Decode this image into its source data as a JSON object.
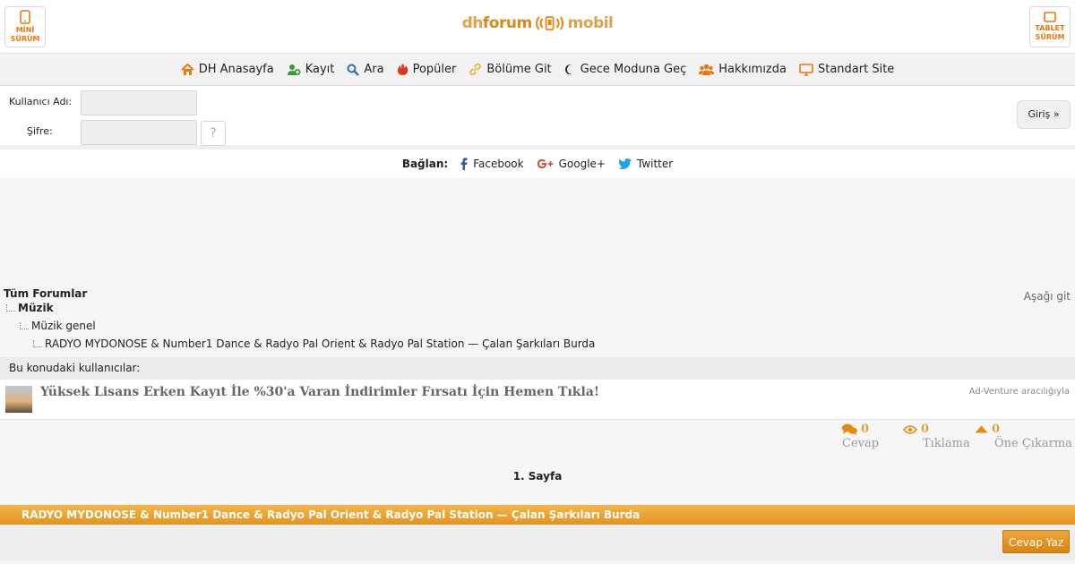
{
  "header": {
    "mini_label": "MİNİ SÜRÜM",
    "tablet_label": "TABLET SÜRÜM",
    "logo": {
      "part1": "dh",
      "part2": "forum",
      "part3": "mobil"
    }
  },
  "nav": {
    "items": [
      {
        "label": "DH Anasayfa",
        "icon": "home-icon"
      },
      {
        "label": "Kayıt",
        "icon": "add-user-icon"
      },
      {
        "label": "Ara",
        "icon": "search-icon"
      },
      {
        "label": "Popüler",
        "icon": "fire-icon"
      },
      {
        "label": "Bölüme Git",
        "icon": "link-icon"
      },
      {
        "label": "Gece Moduna Geç",
        "icon": "moon-icon"
      },
      {
        "label": "Hakkımızda",
        "icon": "users-icon"
      },
      {
        "label": "Standart Site",
        "icon": "monitor-icon"
      }
    ]
  },
  "login": {
    "username_label": "Kullanıcı Adı:",
    "password_label": "Şifre:",
    "username_value": "",
    "password_value": "",
    "help_label": "?",
    "submit_label": "Giriş »"
  },
  "connect": {
    "label": "Bağlan:",
    "facebook": "Facebook",
    "google": "Google+",
    "twitter": "Twitter"
  },
  "breadcrumbs": {
    "all": "Tüm Forumlar",
    "go_down": "Aşağı git",
    "level1": "Müzik",
    "level2": "Müzik genel",
    "level3": "RADYO MYDONOSE & Number1 Dance & Radyo Pal Orient & Radyo Pal Station — Çalan Şarkıları Burda"
  },
  "users_in_topic": "Bu konudaki kullanıcılar:",
  "ad": {
    "title": "Yüksek Lisans Erken Kayıt İle %30'a Varan İndirimler Fırsatı İçin Hemen Tıkla!",
    "via": "Ad-Venture aracılığıyla"
  },
  "stats": {
    "replies": {
      "value": "0",
      "label": "Cevap"
    },
    "views": {
      "value": "0",
      "label": "Tıklama"
    },
    "boosts": {
      "value": "0",
      "label": "Öne Çıkarma"
    }
  },
  "page_label": "1. Sayfa",
  "topic_title": "RADYO MYDONOSE & Number1 Dance & Radyo Pal Orient & Radyo Pal Station — Çalan Şarkıları Burda",
  "reply_button": "Cevap Yaz",
  "colors": {
    "accent": "#e8890f",
    "brand": "#d68a1c"
  }
}
